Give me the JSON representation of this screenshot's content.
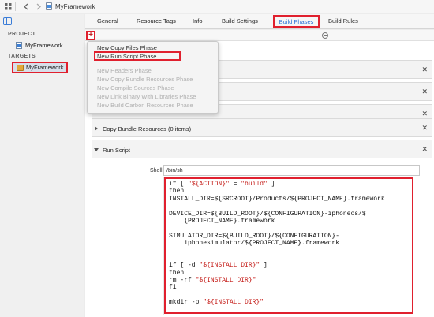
{
  "window": {
    "breadcrumb_title": "MyFramework"
  },
  "sidebar": {
    "project_header": "PROJECT",
    "project_item": "MyFramework",
    "targets_header": "TARGETS",
    "target_item": "MyFramework"
  },
  "tabs": [
    {
      "label": "General"
    },
    {
      "label": "Resource Tags"
    },
    {
      "label": "Info"
    },
    {
      "label": "Build Settings"
    },
    {
      "label": "Build Phases",
      "active": true
    },
    {
      "label": "Build Rules"
    }
  ],
  "toolbar": {
    "add_symbol": "+"
  },
  "menu": {
    "items": [
      {
        "label": "New Copy Files Phase",
        "enabled": true
      },
      {
        "label": "New Run Script Phase",
        "enabled": true,
        "highlighted": true
      },
      {
        "label": "New Headers Phase",
        "enabled": false
      },
      {
        "label": "New Copy Bundle Resources Phase",
        "enabled": false
      },
      {
        "label": "New Compile Sources Phase",
        "enabled": false
      },
      {
        "label": "New Link Binary With Libraries Phase",
        "enabled": false
      },
      {
        "label": "New Build Carbon Resources Phase",
        "enabled": false
      }
    ]
  },
  "phases": [
    {
      "label": "",
      "collapsed": true
    },
    {
      "label": "",
      "collapsed": true
    },
    {
      "label": "",
      "collapsed": true
    },
    {
      "label": "Copy Bundle Resources (0 items)",
      "collapsed": true
    },
    {
      "label": "Run Script",
      "collapsed": false
    }
  ],
  "run_script": {
    "shell_label": "Shell",
    "shell_value": "/bin/sh",
    "code_lines": [
      [
        "if [ ",
        {
          "s": "\"${ACTION}\""
        },
        " = ",
        {
          "s": "\"build\""
        },
        " ]"
      ],
      [
        "then"
      ],
      [
        "INSTALL_DIR=${SRCROOT}/Products/${PROJECT_NAME}.framework"
      ],
      [
        ""
      ],
      [
        "DEVICE_DIR=${BUILD_ROOT}/${CONFIGURATION}-iphoneos/$"
      ],
      [
        "    {PROJECT_NAME}.framework"
      ],
      [
        ""
      ],
      [
        "SIMULATOR_DIR=${BUILD_ROOT}/${CONFIGURATION}-"
      ],
      [
        "    iphonesimulator/${PROJECT_NAME}.framework"
      ],
      [
        ""
      ],
      [
        ""
      ],
      [
        "if [ -d ",
        {
          "s": "\"${INSTALL_DIR}\""
        },
        " ]"
      ],
      [
        "then"
      ],
      [
        "rm -rf ",
        {
          "s": "\"${INSTALL_DIR}\""
        }
      ],
      [
        "fi"
      ],
      [
        ""
      ],
      [
        "mkdir -p ",
        {
          "s": "\"${INSTALL_DIR}\""
        }
      ]
    ]
  },
  "colors": {
    "annotation_red": "#e0202e",
    "active_tab_blue": "#2a6fd6",
    "string_red": "#c41a16"
  }
}
